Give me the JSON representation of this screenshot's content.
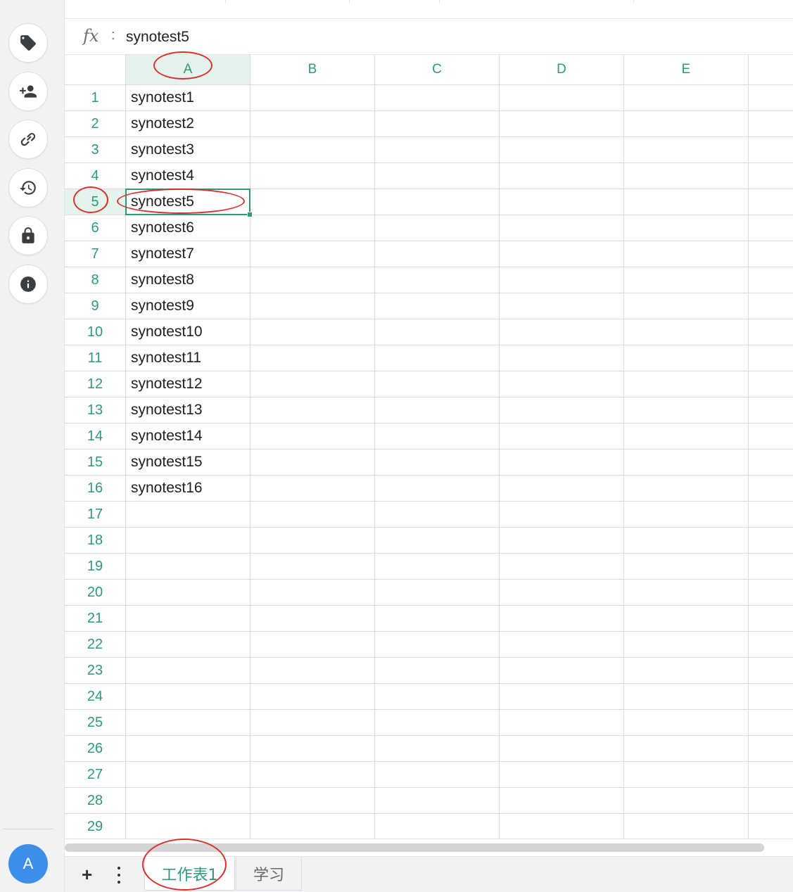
{
  "formula_bar": {
    "fx_label": "fx",
    "separator": ":",
    "value": "synotest5"
  },
  "sidebar": {
    "buttons": [
      {
        "icon": "tag-icon"
      },
      {
        "icon": "add-user-icon"
      },
      {
        "icon": "link-icon"
      },
      {
        "icon": "history-icon"
      },
      {
        "icon": "lock-icon"
      },
      {
        "icon": "info-icon"
      }
    ],
    "avatar_letter": "A"
  },
  "grid": {
    "columns": [
      "A",
      "B",
      "C",
      "D",
      "E"
    ],
    "selected_column": "A",
    "selected_row": "5",
    "rows": [
      {
        "num": "1",
        "a": "synotest1"
      },
      {
        "num": "2",
        "a": "synotest2"
      },
      {
        "num": "3",
        "a": "synotest3"
      },
      {
        "num": "4",
        "a": "synotest4"
      },
      {
        "num": "5",
        "a": "synotest5"
      },
      {
        "num": "6",
        "a": "synotest6"
      },
      {
        "num": "7",
        "a": "synotest7"
      },
      {
        "num": "8",
        "a": "synotest8"
      },
      {
        "num": "9",
        "a": "synotest9"
      },
      {
        "num": "10",
        "a": "synotest10"
      },
      {
        "num": "11",
        "a": "synotest11"
      },
      {
        "num": "12",
        "a": "synotest12"
      },
      {
        "num": "13",
        "a": "synotest13"
      },
      {
        "num": "14",
        "a": "synotest14"
      },
      {
        "num": "15",
        "a": "synotest15"
      },
      {
        "num": "16",
        "a": "synotest16"
      },
      {
        "num": "17",
        "a": ""
      },
      {
        "num": "18",
        "a": ""
      },
      {
        "num": "19",
        "a": ""
      },
      {
        "num": "20",
        "a": ""
      },
      {
        "num": "21",
        "a": ""
      },
      {
        "num": "22",
        "a": ""
      },
      {
        "num": "23",
        "a": ""
      },
      {
        "num": "24",
        "a": ""
      },
      {
        "num": "25",
        "a": ""
      },
      {
        "num": "26",
        "a": ""
      },
      {
        "num": "27",
        "a": ""
      },
      {
        "num": "28",
        "a": ""
      },
      {
        "num": "29",
        "a": ""
      }
    ]
  },
  "sheet_tabs": {
    "add_label": "+",
    "tabs": [
      {
        "label": "工作表1",
        "active": true
      },
      {
        "label": "学习",
        "active": false
      }
    ]
  },
  "colors": {
    "accent": "#2f9a72",
    "selection_fill": "#e4f3ec",
    "annotation": "#d9302e",
    "avatar": "#3d8ee8"
  }
}
